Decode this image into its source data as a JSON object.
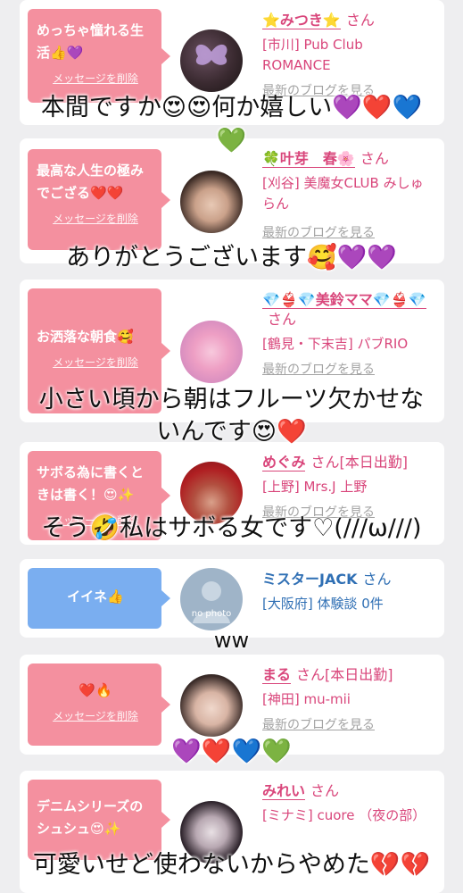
{
  "cards": [
    {
      "message": "めっちゃ憧れる生活👍💜",
      "delete_label": "メッセージを削除",
      "name": "⭐みつき⭐",
      "san": "さん",
      "shop": "[市川] Pub Club ROMANCE",
      "blog": "最新のブログを見る"
    },
    {
      "message": "最高な人生の極みでござる❤️❤️",
      "delete_label": "メッセージを削除",
      "name": "🍀叶芽　春🌸",
      "san": "さん",
      "shop": "[刈谷] 美魔女CLUB みしゅらん",
      "blog": "最新のブログを見る"
    },
    {
      "message": "お洒落な朝食🥰",
      "delete_label": "メッセージを削除",
      "name": "💎👙💎美鈴ママ💎👙💎",
      "san": "さん",
      "shop": "[鶴見・下末吉] パブRIO",
      "blog": "最新のブログを見る"
    },
    {
      "message": "サボる為に書くときは書く！😍✨",
      "delete_label": "メッセージを削除",
      "name": "めぐみ",
      "san": "さん[本日出勤]",
      "shop": "[上野] Mrs.J 上野",
      "blog": "最新のブログを見る"
    },
    {
      "message": "イイネ👍",
      "delete_label": "",
      "name": "ミスターJACK",
      "san": "さん",
      "shop": "[大阪府] 体験談 0件",
      "blog": "",
      "avatar_text": "no photo"
    },
    {
      "message": "❤️🔥",
      "delete_label": "メッセージを削除",
      "name": "まる",
      "san": "さん[本日出勤]",
      "shop": "[神田] mu-mii",
      "blog": "最新のブログを見る"
    },
    {
      "message": "デニムシリーズのシュシュ😍✨",
      "delete_label": "",
      "name": "みれい",
      "san": "さん",
      "shop": "[ミナミ] cuore （夜の部）",
      "blog": ""
    }
  ],
  "captions": {
    "c1": "本間ですか😍😍何か嬉しい💜❤️💙",
    "c1b": "💚",
    "c2": "ありがとうございます🥰💜💜",
    "c3": "小さい頃から朝はフルーツ欠かせな",
    "c3b": "いんです😍❤️",
    "c4": "そう🤣私はサボる女です♡(///ω///)",
    "c5": "ww",
    "c6": "💜❤️💙💚",
    "c7": "可愛いせど使わないからやめた💔💔"
  },
  "colors": {
    "background": "#eeeef0",
    "bubble_pink": "#f4909f",
    "bubble_blue": "#7aaef0",
    "name_pink": "#d9467b",
    "name_blue": "#2f6fb4",
    "blog_gray": "#a3a3a3"
  }
}
